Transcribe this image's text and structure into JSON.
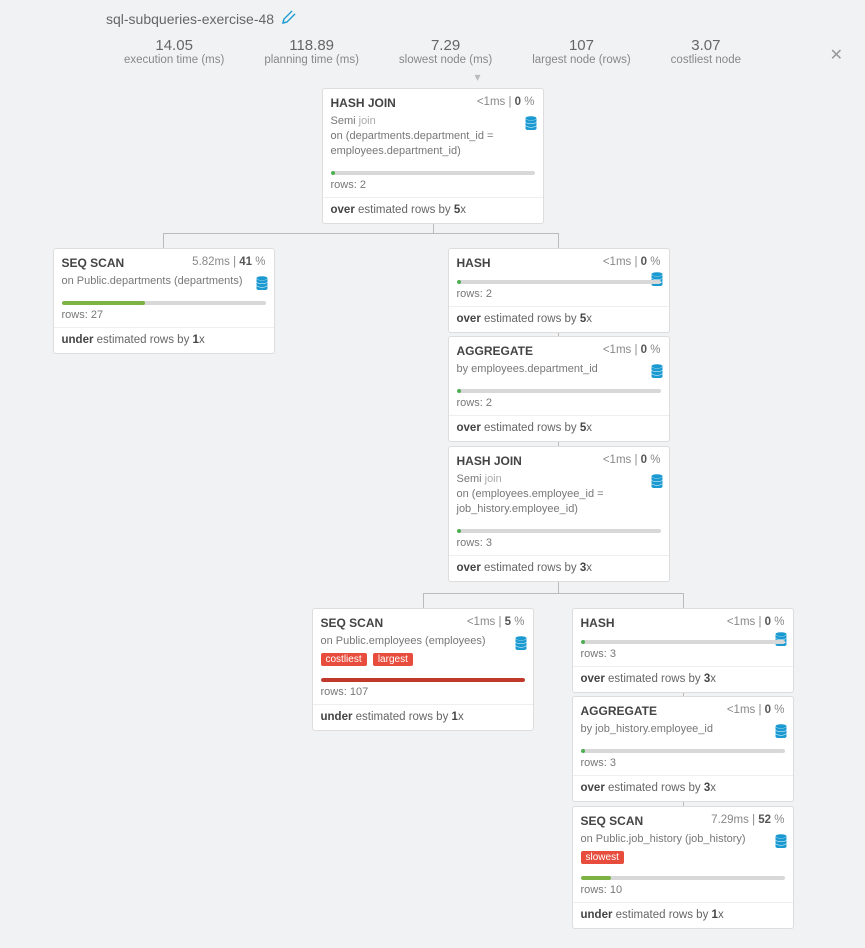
{
  "page": {
    "title": "sql-subqueries-exercise-48"
  },
  "stats": [
    {
      "value": "14.05",
      "label": "execution time (ms)"
    },
    {
      "value": "118.89",
      "label": "planning time (ms)"
    },
    {
      "value": "7.29",
      "label": "slowest node (ms)"
    },
    {
      "value": "107",
      "label": "largest node (rows)"
    },
    {
      "value": "3.07",
      "label": "costliest node"
    }
  ],
  "nodes": {
    "n0": {
      "type": "HASH JOIN",
      "time_text": "<1ms",
      "pct": "0",
      "desc_prefix": "Semi",
      "desc_muted": "join",
      "desc_line2": "on (departments.department_id = employees.department_id)",
      "rows": "2",
      "fill_color": "#4caf50",
      "fill_pct": 2,
      "est_bold1": "over",
      "est_mid": " estimated rows by ",
      "est_bold2": "5",
      "est_tail": "x"
    },
    "n1": {
      "type": "SEQ SCAN",
      "time_text": "5.82ms",
      "pct": "41",
      "desc": "on Public.departments (departments)",
      "rows": "27",
      "fill_color": "#7cb342",
      "fill_pct": 41,
      "est_bold1": "under",
      "est_mid": " estimated rows by ",
      "est_bold2": "1",
      "est_tail": "x"
    },
    "n2": {
      "type": "HASH",
      "time_text": "<1ms",
      "pct": "0",
      "rows": "2",
      "fill_color": "#4caf50",
      "fill_pct": 2,
      "est_bold1": "over",
      "est_mid": " estimated rows by ",
      "est_bold2": "5",
      "est_tail": "x"
    },
    "n3": {
      "type": "AGGREGATE",
      "time_text": "<1ms",
      "pct": "0",
      "desc": "by employees.department_id",
      "rows": "2",
      "fill_color": "#4caf50",
      "fill_pct": 2,
      "est_bold1": "over",
      "est_mid": " estimated rows by ",
      "est_bold2": "5",
      "est_tail": "x"
    },
    "n4": {
      "type": "HASH JOIN",
      "time_text": "<1ms",
      "pct": "0",
      "desc_prefix": "Semi",
      "desc_muted": "join",
      "desc_line2": "on (employees.employee_id = job_history.employee_id)",
      "rows": "3",
      "fill_color": "#4caf50",
      "fill_pct": 2,
      "est_bold1": "over",
      "est_mid": " estimated rows by ",
      "est_bold2": "3",
      "est_tail": "x"
    },
    "n5": {
      "type": "SEQ SCAN",
      "time_text": "<1ms",
      "pct": "5",
      "desc": "on Public.employees (employees)",
      "tags": [
        "costliest",
        "largest"
      ],
      "rows": "107",
      "fill_color": "#c0392b",
      "fill_pct": 100,
      "est_bold1": "under",
      "est_mid": " estimated rows by ",
      "est_bold2": "1",
      "est_tail": "x"
    },
    "n6": {
      "type": "HASH",
      "time_text": "<1ms",
      "pct": "0",
      "rows": "3",
      "fill_color": "#4caf50",
      "fill_pct": 2,
      "est_bold1": "over",
      "est_mid": " estimated rows by ",
      "est_bold2": "3",
      "est_tail": "x"
    },
    "n7": {
      "type": "AGGREGATE",
      "time_text": "<1ms",
      "pct": "0",
      "desc": "by job_history.employee_id",
      "rows": "3",
      "fill_color": "#4caf50",
      "fill_pct": 2,
      "est_bold1": "over",
      "est_mid": " estimated rows by ",
      "est_bold2": "3",
      "est_tail": "x"
    },
    "n8": {
      "type": "SEQ SCAN",
      "time_text": "7.29ms",
      "pct": "52",
      "desc": "on Public.job_history (job_history)",
      "tags": [
        "slowest"
      ],
      "rows": "10",
      "fill_color": "#7cb342",
      "fill_pct": 15,
      "est_bold1": "under",
      "est_mid": " estimated rows by ",
      "est_bold2": "1",
      "est_tail": "x"
    }
  },
  "labels": {
    "rows_prefix": "rows: "
  }
}
